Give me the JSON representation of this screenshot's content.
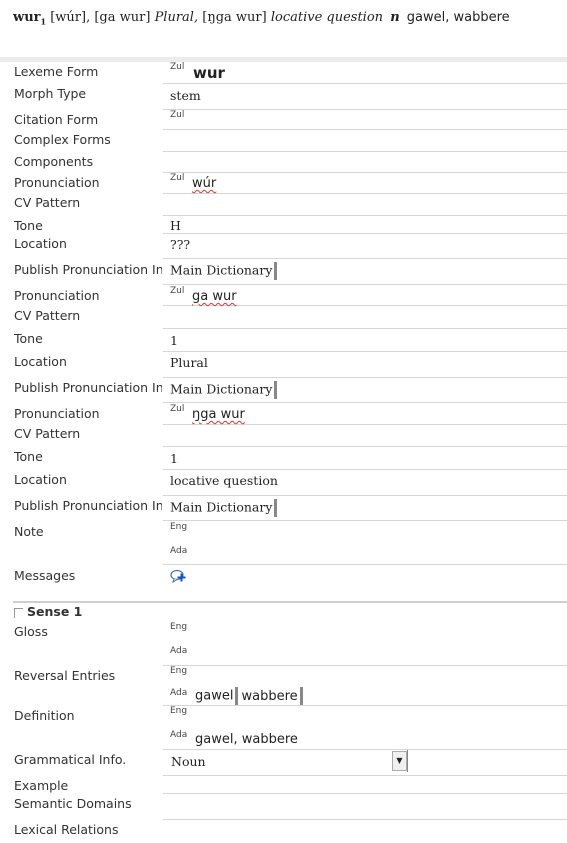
{
  "header": {
    "headword": "wur",
    "homograph": "1",
    "p1": "[wúr],",
    "p2": "[ga wur]",
    "p2_label": "Plural,",
    "p3": "[ŋga wur]",
    "p3_label": "locative question",
    "pos": "n",
    "gloss": "gawel, wabbere"
  },
  "labels": {
    "lexeme_form": "Lexeme Form",
    "morph_type": "Morph Type",
    "citation_form": "Citation Form",
    "complex_forms": "Complex Forms",
    "components": "Components",
    "pronunciation": "Pronunciation",
    "cv_pattern": "CV Pattern",
    "tone": "Tone",
    "location": "Location",
    "publish_pron": "Publish Pronunciation In",
    "note": "Note",
    "messages": "Messages",
    "sense": "Sense 1",
    "gloss": "Gloss",
    "reversal": "Reversal Entries",
    "definition": "Definition",
    "gram_info": "Grammatical Info.",
    "example": "Example",
    "semantic_domains": "Semantic Domains",
    "lexical_relations": "Lexical Relations"
  },
  "ws": {
    "zul": "Zul",
    "eng": "Eng",
    "ada": "Ada"
  },
  "values": {
    "lexeme_form": "wur",
    "morph_type": "stem",
    "pron1": "wúr",
    "tone1": "H",
    "loc1": "???",
    "publish": "Main Dictionary",
    "pron2": "ga wur",
    "tone2": "1",
    "loc2": "Plural",
    "pron3": "ŋga wur",
    "tone3": "1",
    "loc3": "locative question",
    "rev1": "gawel",
    "rev2": "wabbere",
    "definition_ada": "gawel, wabbere",
    "gram_info": "Noun"
  },
  "icons": {
    "messages": "add-message-icon",
    "dropdown": "dropdown-arrow-icon"
  }
}
